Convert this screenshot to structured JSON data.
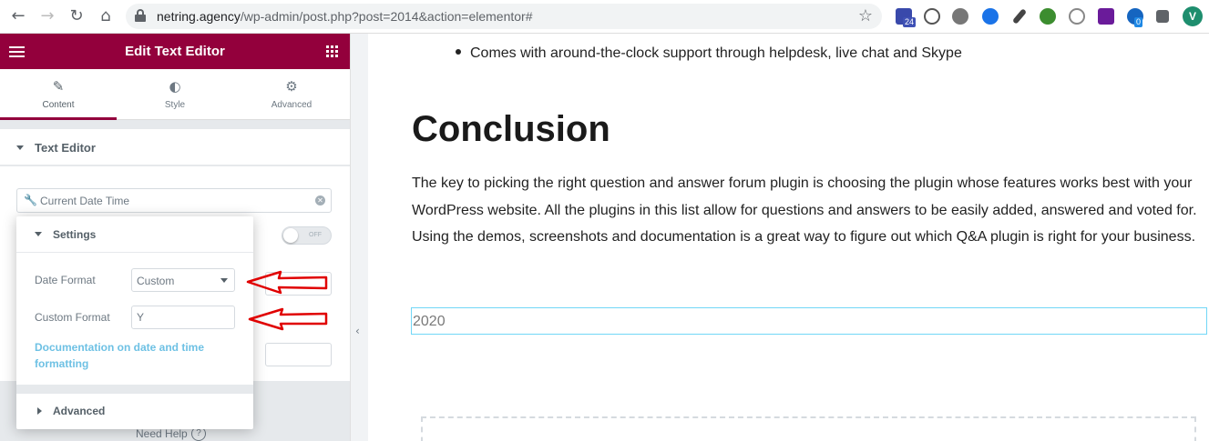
{
  "browser": {
    "url_host": "netring.agency",
    "url_path": "/wp-admin/post.php?post=2014&action=elementor#",
    "extension_badge": "24",
    "extension_badge_2": "0",
    "profile_initial": "V"
  },
  "panel": {
    "title": "Edit Text Editor",
    "tabs": [
      {
        "label": "Content",
        "icon": "pencil-icon"
      },
      {
        "label": "Style",
        "icon": "half-circle-icon"
      },
      {
        "label": "Advanced",
        "icon": "gear-icon"
      }
    ],
    "section_title": "Text Editor",
    "dynamic_tag_label": "Current Date Time",
    "toggle_label": "OFF",
    "need_help": "Need Help",
    "help_icon_glyph": "?"
  },
  "popover": {
    "title": "Settings",
    "date_format_label": "Date Format",
    "date_format_value": "Custom",
    "custom_format_label": "Custom Format",
    "custom_format_value": "Y",
    "doc_link": "Documentation on date and time formatting",
    "advanced_title": "Advanced"
  },
  "preview": {
    "bullet_text": "Comes with around-the-clock support through helpdesk, live chat and Skype",
    "heading": "Conclusion",
    "paragraph": "The key to picking the right question and answer forum plugin is choosing the plugin whose features works best with your WordPress website. All the plugins in this list allow for questions and answers to be easily added, answered and voted for. Using the demos, screenshots and documentation is a great way to figure out which Q&A plugin is right for your business.",
    "date_output": "2020"
  },
  "colors": {
    "elementor_brand": "#93003c",
    "link": "#6ec1e4",
    "annotation_arrow": "#e00000",
    "selected_border": "#71d7f7"
  }
}
